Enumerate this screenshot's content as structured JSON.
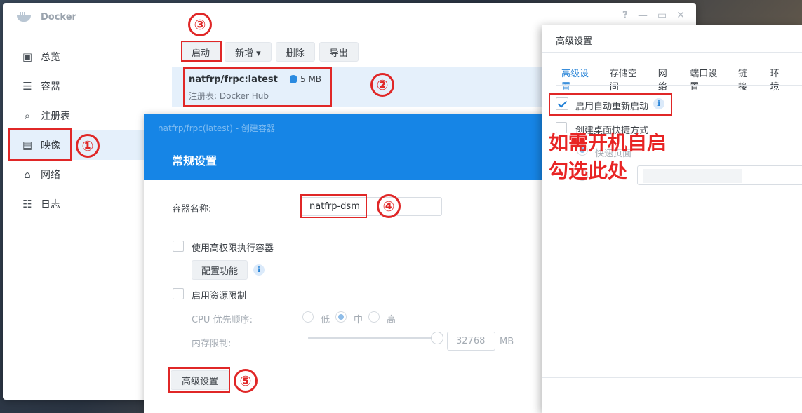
{
  "docker": {
    "title": "Docker",
    "controls": {
      "help": "?",
      "minimize": "—",
      "maximize": "▭",
      "close": "✕"
    },
    "sidebar": {
      "items": [
        {
          "label": "总览",
          "icon": "overview-icon"
        },
        {
          "label": "容器",
          "icon": "container-icon"
        },
        {
          "label": "注册表",
          "icon": "registry-icon"
        },
        {
          "label": "映像",
          "icon": "image-icon",
          "active": true
        },
        {
          "label": "网络",
          "icon": "network-icon"
        },
        {
          "label": "日志",
          "icon": "log-icon"
        }
      ]
    },
    "toolbar": {
      "start": "启动",
      "add": "新增 ▾",
      "delete": "删除",
      "export": "导出"
    },
    "image": {
      "name": "natfrp/frpc:latest",
      "size": "5 MB",
      "registry": "注册表: Docker Hub"
    }
  },
  "dialog": {
    "subtitle": "natfrp/frpc(latest) - 创建容器",
    "title": "常规设置",
    "container_name_label": "容器名称:",
    "container_name_value": "natfrp-dsm",
    "privileged_label": "使用高权限执行容器",
    "config_button": "配置功能",
    "resource_limit_label": "启用资源限制",
    "cpu_priority_label": "CPU 优先顺序:",
    "cpu_options": [
      "低",
      "中",
      "高"
    ],
    "cpu_selected": "中",
    "memory_label": "内存限制:",
    "memory_value": "32768",
    "memory_unit": "MB",
    "advanced_button": "高级设置"
  },
  "advanced": {
    "title": "高级设置",
    "tabs": [
      "高级设置",
      "存储空间",
      "网络",
      "端口设置",
      "链接",
      "环境"
    ],
    "active_tab": "高级设置",
    "auto_restart_label": "启用自动重新启动",
    "auto_restart_checked": true,
    "desktop_shortcut_label": "创建桌面快捷方式",
    "shortcut_option": "快速页面"
  },
  "annotations": {
    "n1": "①",
    "n2": "②",
    "n3": "③",
    "n4": "④",
    "n5": "⑤",
    "note_line1": "如需开机自启",
    "note_line2": "勾选此处"
  },
  "colors": {
    "accent": "#1685e6",
    "annotation": "#e02727",
    "selected_row": "#e5f0fb"
  }
}
